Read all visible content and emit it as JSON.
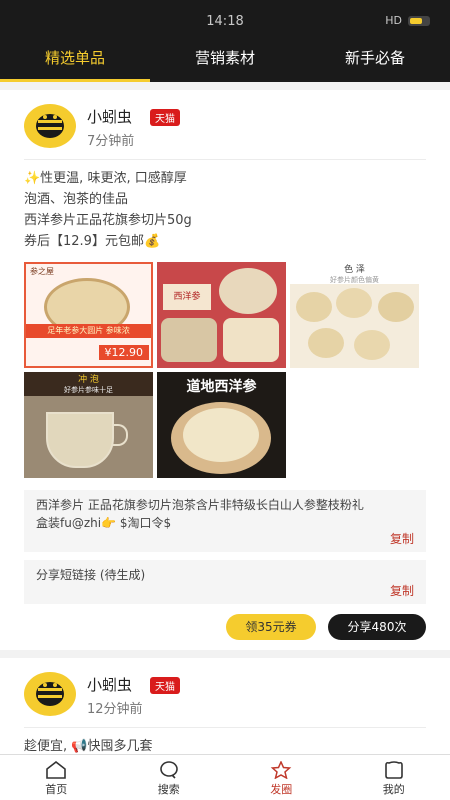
{
  "status": {
    "time": "14:18",
    "network": "HD"
  },
  "tabs": [
    {
      "label": "精选单品",
      "active": true
    },
    {
      "label": "营销素材",
      "active": false
    },
    {
      "label": "新手必备",
      "active": false
    }
  ],
  "posts": [
    {
      "user": "小蚓虫",
      "badge": "天猫",
      "time": "7分钟前",
      "lines": [
        "✨性更温, 味更浓, 口感醇厚",
        "泡酒、泡茶的佳品",
        "西洋参片正品花旗参切片50g",
        "券后【12.9】元包邮💰"
      ],
      "images": [
        {
          "caption": "足年老参大圆片 参味浓",
          "price": "¥12.90",
          "tag": "参之屋"
        },
        {
          "caption": "西洋参",
          "price": "",
          "tag": ""
        },
        {
          "caption": "好参片颜色偏黄",
          "price": "",
          "tag": "色 泽"
        },
        {
          "caption": "好参片参味十足",
          "price": "",
          "tag": "冲 泡"
        },
        {
          "caption": "道地西洋参",
          "price": "",
          "tag": ""
        }
      ],
      "copy_text": "西洋参片 正品花旗参切片泡茶含片非特级长白山人参整枝粉礼盒装fu@zhi👉 $淘口令$",
      "copy_label": "复制",
      "short_link": "分享短链接 (待生成)",
      "short_copy_label": "复制",
      "coupon_label": "领35元券",
      "share_label": "分享480次"
    },
    {
      "user": "小蚓虫",
      "badge": "天猫",
      "time": "12分钟前",
      "lines": [
        "趁便宜, 📢快囤多几套"
      ]
    }
  ],
  "nav": [
    {
      "label": "首页",
      "icon": "home-icon",
      "active": false
    },
    {
      "label": "搜索",
      "icon": "search-icon",
      "active": false
    },
    {
      "label": "发圈",
      "icon": "star-icon",
      "active": true
    },
    {
      "label": "我的",
      "icon": "profile-icon",
      "active": false
    }
  ],
  "colors": {
    "accent": "#f5cc2e",
    "dark": "#1a1a1a",
    "badge": "#d91c1c",
    "copy": "#c0392b"
  }
}
